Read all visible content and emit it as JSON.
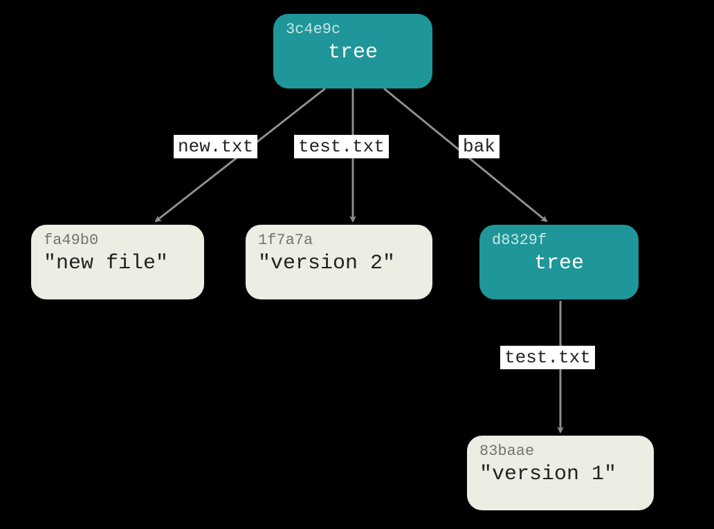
{
  "colors": {
    "tree": "#1f9699",
    "blob": "#ecede3",
    "arrow": "#8e8e8e"
  },
  "nodes": {
    "root": {
      "hash": "3c4e9c",
      "label": "tree",
      "type": "tree"
    },
    "blob_new": {
      "hash": "fa49b0",
      "label": "\"new file\"",
      "type": "blob"
    },
    "blob_v2": {
      "hash": "1f7a7a",
      "label": "\"version 2\"",
      "type": "blob"
    },
    "subtree_bak": {
      "hash": "d8329f",
      "label": "tree",
      "type": "tree"
    },
    "blob_v1": {
      "hash": "83baae",
      "label": "\"version 1\"",
      "type": "blob"
    }
  },
  "edges": {
    "root_to_new": {
      "label": "new.txt"
    },
    "root_to_v2": {
      "label": "test.txt"
    },
    "root_to_bak": {
      "label": "bak"
    },
    "bak_to_v1": {
      "label": "test.txt"
    }
  }
}
